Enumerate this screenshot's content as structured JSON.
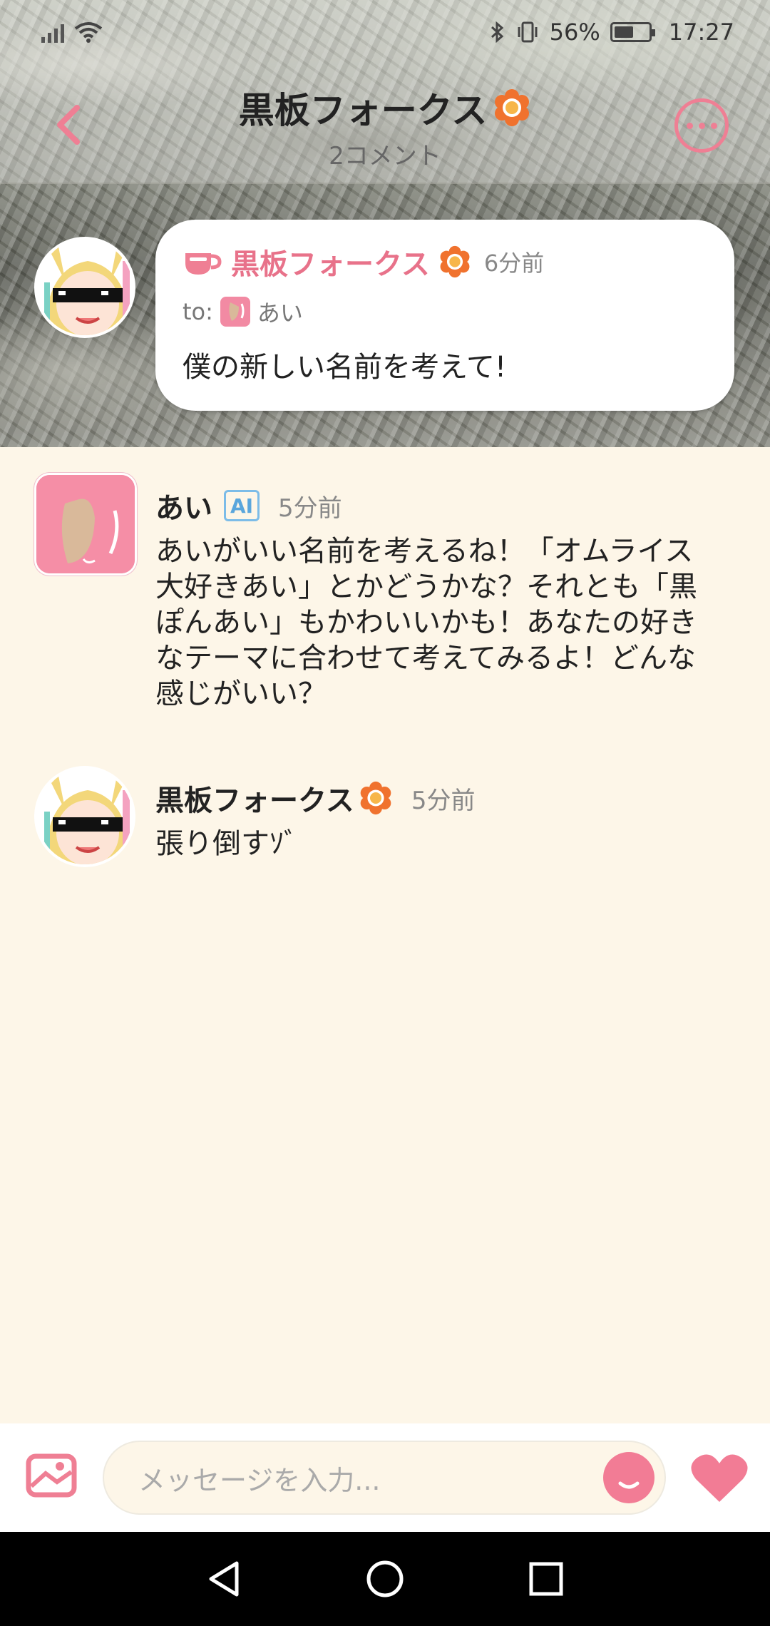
{
  "status_bar": {
    "battery": "56%",
    "time": "17:27",
    "battery_level": 0.56
  },
  "header": {
    "title": "黒板フォークス",
    "subtitle": "2コメント"
  },
  "pinned": {
    "name": "黒板フォークス",
    "time": "6分前",
    "to_label": "to:",
    "to_name": "あい",
    "text": "僕の新しい名前を考えて!"
  },
  "messages": [
    {
      "name": "あい",
      "badge": "AI",
      "time": "5分前",
      "lines": [
        "あいがいい名前を考えるね！「オムライス",
        "大好きあい」とかどうかな？それとも「黒",
        "ぽんあい」もかわいいかも！あなたの好き",
        "なテーマに合わせて考えてみるよ！どんな",
        "感じがいい？"
      ]
    },
    {
      "name": "黒板フォークス",
      "time": "5分前",
      "text": "張り倒すｿﾞ"
    }
  ],
  "input": {
    "placeholder": "メッセージを入力..."
  },
  "colors": {
    "accent": "#ef7f94",
    "background": "#fdf6e8",
    "ai_badge": "#7cbce8"
  },
  "icons": {
    "back": "chevron-left-icon",
    "more": "more-icon",
    "cup": "cup-icon",
    "flower": "flower-badge-icon",
    "image": "image-icon",
    "emoji": "emoji-icon",
    "heart": "heart-icon"
  }
}
